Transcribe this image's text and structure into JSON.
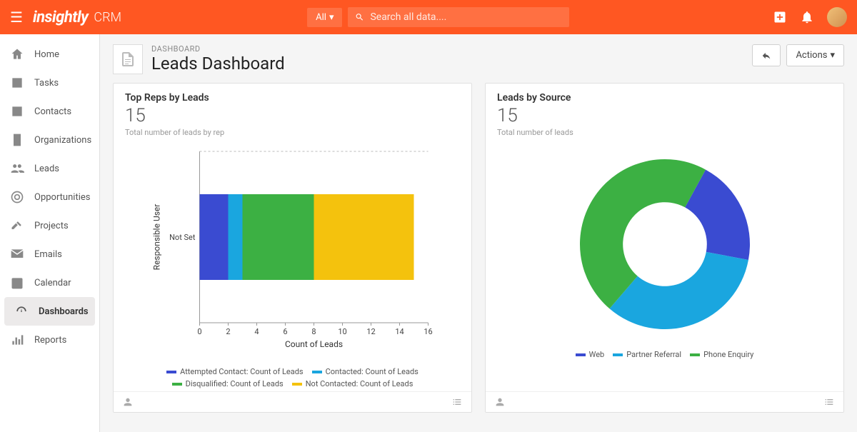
{
  "brand": {
    "name": "insightly",
    "product": "CRM"
  },
  "topbar": {
    "all_label": "All",
    "search_placeholder": "Search all data...."
  },
  "sidebar": {
    "items": [
      {
        "label": "Home",
        "icon": "home"
      },
      {
        "label": "Tasks",
        "icon": "check"
      },
      {
        "label": "Contacts",
        "icon": "contact"
      },
      {
        "label": "Organizations",
        "icon": "building"
      },
      {
        "label": "Leads",
        "icon": "group"
      },
      {
        "label": "Opportunities",
        "icon": "target"
      },
      {
        "label": "Projects",
        "icon": "hammer"
      },
      {
        "label": "Emails",
        "icon": "mail"
      },
      {
        "label": "Calendar",
        "icon": "calendar"
      },
      {
        "label": "Dashboards",
        "icon": "gauge",
        "active": true
      },
      {
        "label": "Reports",
        "icon": "bars"
      }
    ]
  },
  "header": {
    "breadcrumb": "DASHBOARD",
    "title": "Leads Dashboard",
    "actions_label": "Actions"
  },
  "cards": [
    {
      "title": "Top Reps by Leads",
      "value": "15",
      "subtitle": "Total number of leads by rep"
    },
    {
      "title": "Leads by Source",
      "value": "15",
      "subtitle": "Total number of leads"
    }
  ],
  "chart_data": [
    {
      "type": "bar",
      "orientation": "horizontal-stacked",
      "xlabel": "Count of Leads",
      "ylabel": "Responsible User",
      "xlim": [
        0,
        16
      ],
      "xticks": [
        0,
        2,
        4,
        6,
        8,
        10,
        12,
        14,
        16
      ],
      "categories": [
        "Not Set"
      ],
      "series": [
        {
          "name": "Attempted Contact: Count of Leads",
          "color": "#3a4bd1",
          "values": [
            2
          ]
        },
        {
          "name": "Contacted: Count of Leads",
          "color": "#1aa6df",
          "values": [
            1
          ]
        },
        {
          "name": "Disqualified: Count of Leads",
          "color": "#3cb043",
          "values": [
            5
          ]
        },
        {
          "name": "Not Contacted: Count of Leads",
          "color": "#f4c20d",
          "values": [
            7
          ]
        }
      ]
    },
    {
      "type": "pie",
      "style": "donut",
      "series": [
        {
          "name": "Web",
          "color": "#3a4bd1",
          "value": 3
        },
        {
          "name": "Partner Referral",
          "color": "#1aa6df",
          "value": 5
        },
        {
          "name": "Phone Enquiry",
          "color": "#3cb043",
          "value": 7
        }
      ]
    }
  ]
}
